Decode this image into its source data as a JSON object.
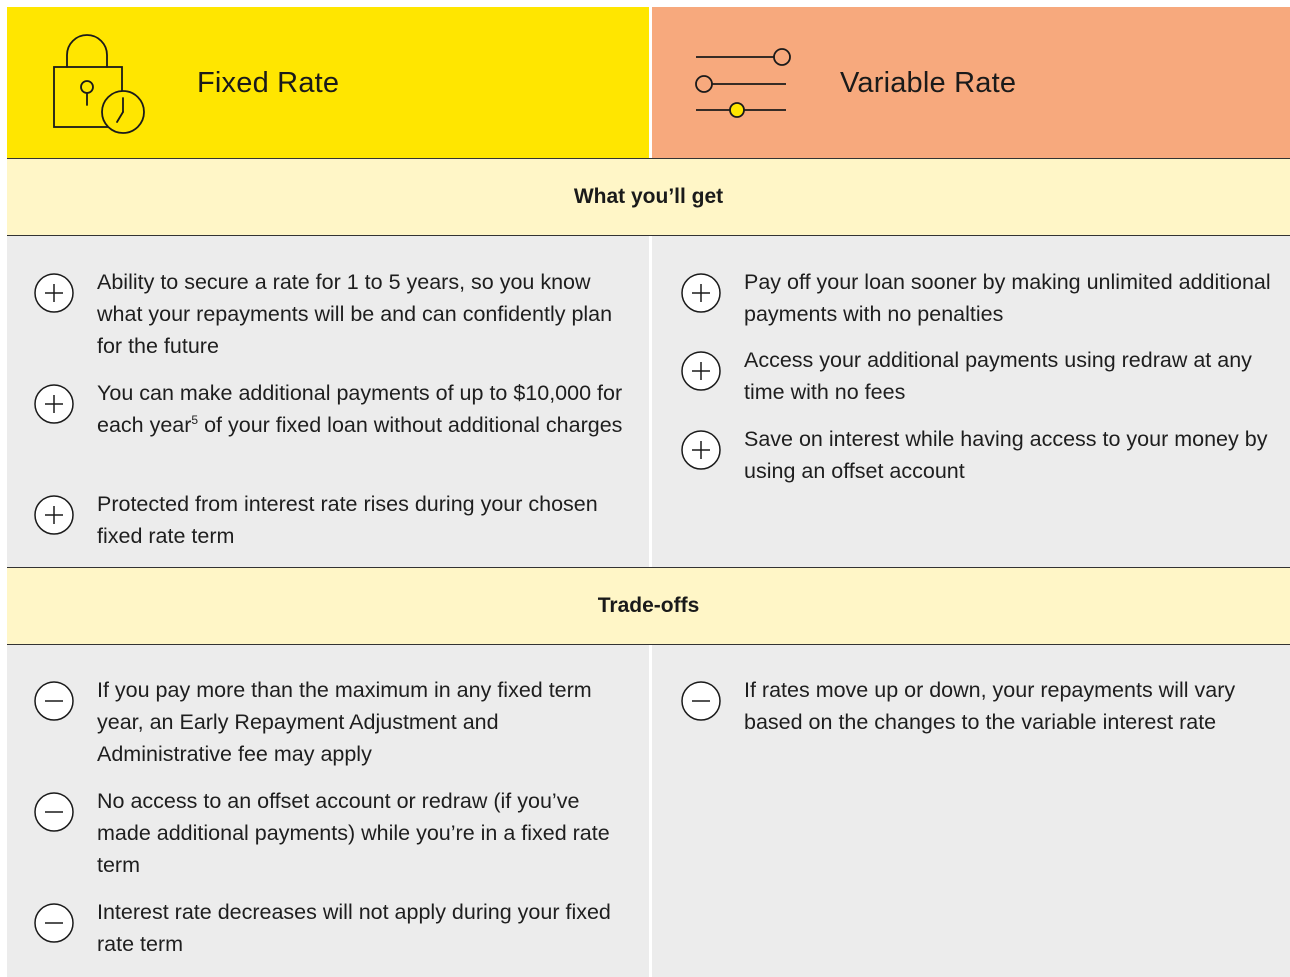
{
  "header": {
    "fixed_title": "Fixed Rate",
    "variable_title": "Variable Rate",
    "fixed_icon": "padlock-clock-icon",
    "variable_icon": "sliders-icon"
  },
  "sections": {
    "get_title": "What you’ll get",
    "trade_title": "Trade-offs"
  },
  "get": {
    "fixed": [
      "Ability to secure a rate for 1 to 5 years, so you know what your repayments will be and can confidently plan for the future",
      {
        "before": "You can make additional payments of up to $10,000 for each year",
        "sup": "5",
        "after": " of your fixed loan without additional charges"
      },
      "Protected from interest rate rises during your chosen fixed rate term"
    ],
    "variable": [
      "Pay off your loan sooner by making unlimited additional payments with no penalties",
      "Access your additional payments using redraw at any time with no fees",
      "Save on interest while having access to your money by using an offset account"
    ]
  },
  "trade": {
    "fixed": [
      "If you pay more than the maximum in any fixed term year, an Early Repayment Adjustment and Administrative fee may apply",
      "No access to an offset account or redraw (if you’ve made additional payments) while you’re in a fixed rate term",
      "Interest rate decreases will not apply during your fixed rate term"
    ],
    "variable": [
      "If rates move up or down, your repayments will vary based on the changes to the variable interest rate"
    ]
  },
  "colors": {
    "fixed_header": "#ffe600",
    "variable_header": "#f7a97d",
    "section_band": "#fff6c7",
    "body": "#ececec"
  }
}
